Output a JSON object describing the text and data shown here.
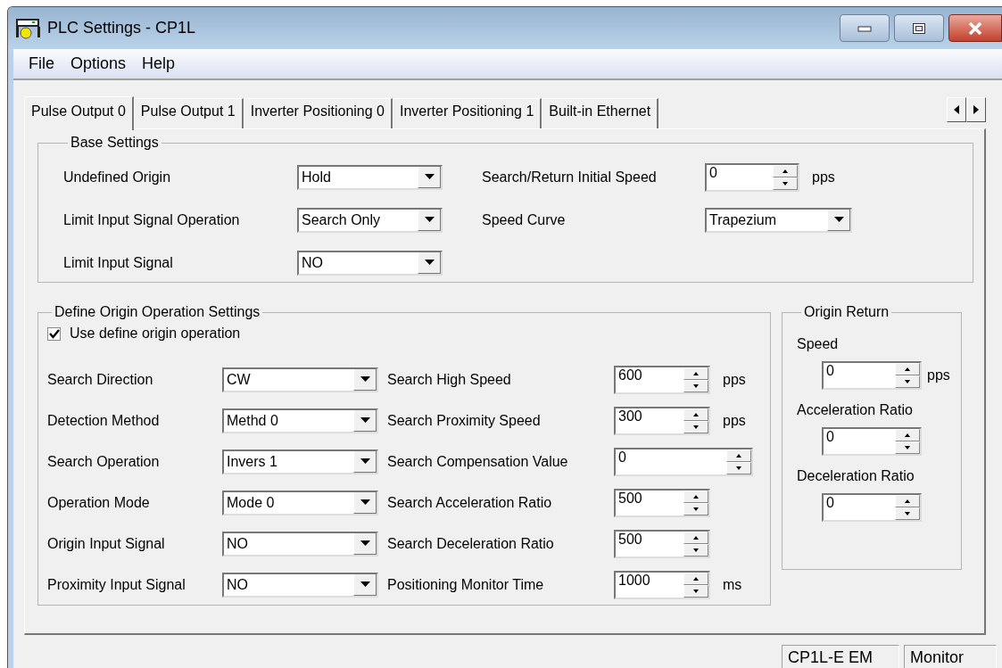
{
  "window": {
    "title": "PLC Settings - CP1L"
  },
  "menu": [
    "File",
    "Options",
    "Help"
  ],
  "tabs": [
    {
      "label": "Pulse Output 0",
      "selected": true
    },
    {
      "label": "Pulse Output 1",
      "selected": false
    },
    {
      "label": "Inverter Positioning 0",
      "selected": false
    },
    {
      "label": "Inverter Positioning 1",
      "selected": false
    },
    {
      "label": "Built-in Ethernet",
      "selected": false
    }
  ],
  "base_settings": {
    "title": "Base Settings",
    "left": [
      {
        "label": "Undefined Origin",
        "value": "Hold"
      },
      {
        "label": "Limit Input Signal Operation",
        "value": "Search Only"
      },
      {
        "label": "Limit Input Signal",
        "value": "NO"
      }
    ],
    "right": [
      {
        "label": "Search/Return Initial Speed",
        "kind": "spin",
        "value": "0",
        "unit": "pps"
      },
      {
        "label": "Speed Curve",
        "kind": "combo",
        "value": "Trapezium"
      }
    ]
  },
  "define_origin": {
    "title": "Define Origin Operation Settings",
    "checkbox": {
      "label": "Use define origin operation",
      "checked": true
    },
    "left": [
      {
        "label": "Search Direction",
        "value": "CW"
      },
      {
        "label": "Detection Method",
        "value": "Methd 0"
      },
      {
        "label": "Search Operation",
        "value": "Invers 1"
      },
      {
        "label": "Operation Mode",
        "value": "Mode 0"
      },
      {
        "label": "Origin Input Signal",
        "value": "NO"
      },
      {
        "label": "Proximity Input Signal",
        "value": "NO"
      }
    ],
    "right": [
      {
        "label": "Search High Speed",
        "kind": "spin",
        "value": "600",
        "unit": "pps"
      },
      {
        "label": "Search Proximity Speed",
        "kind": "spin",
        "value": "300",
        "unit": "pps"
      },
      {
        "label": "Search Compensation Value",
        "kind": "wide-spin",
        "value": "0"
      },
      {
        "label": "Search Acceleration Ratio",
        "kind": "spin",
        "value": "500"
      },
      {
        "label": "Search Deceleration Ratio",
        "kind": "spin",
        "value": "500"
      },
      {
        "label": "Positioning Monitor Time",
        "kind": "spin",
        "value": "1000",
        "unit": "ms"
      }
    ]
  },
  "origin_return": {
    "title": "Origin Return",
    "fields": [
      {
        "label": "Speed",
        "value": "0",
        "unit": "pps"
      },
      {
        "label": "Acceleration Ratio",
        "value": "0"
      },
      {
        "label": "Deceleration Ratio",
        "value": "0"
      }
    ]
  },
  "status_bar": [
    "CP1L-E EM",
    "Monitor"
  ]
}
